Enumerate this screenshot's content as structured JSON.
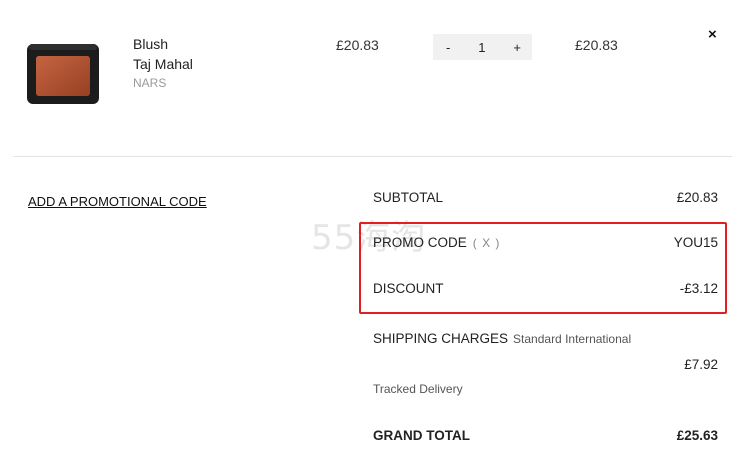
{
  "item": {
    "name_line1": "Blush",
    "name_line2": "Taj Mahal",
    "brand": "NARS",
    "unit_price": "£20.83",
    "quantity": "1",
    "decrement": "-",
    "increment": "+",
    "total_price": "£20.83",
    "remove": "×"
  },
  "promo_link": "ADD A PROMOTIONAL CODE",
  "summary": {
    "subtotal_label": "SUBTOTAL",
    "subtotal_value": "£20.83",
    "promo_label": "PROMO CODE",
    "promo_remove": "( x )",
    "promo_value": "YOU15",
    "discount_label": "DISCOUNT",
    "discount_value": "-£3.12",
    "shipping_label": "SHIPPING CHARGES",
    "shipping_method": "Standard International",
    "shipping_value": "£7.92",
    "shipping_note": "Tracked Delivery",
    "grand_label": "GRAND TOTAL",
    "grand_value": "£25.63"
  },
  "watermark": "55海淘",
  "colors": {
    "highlight": "#e02020",
    "product_pan": "#b2502f"
  }
}
